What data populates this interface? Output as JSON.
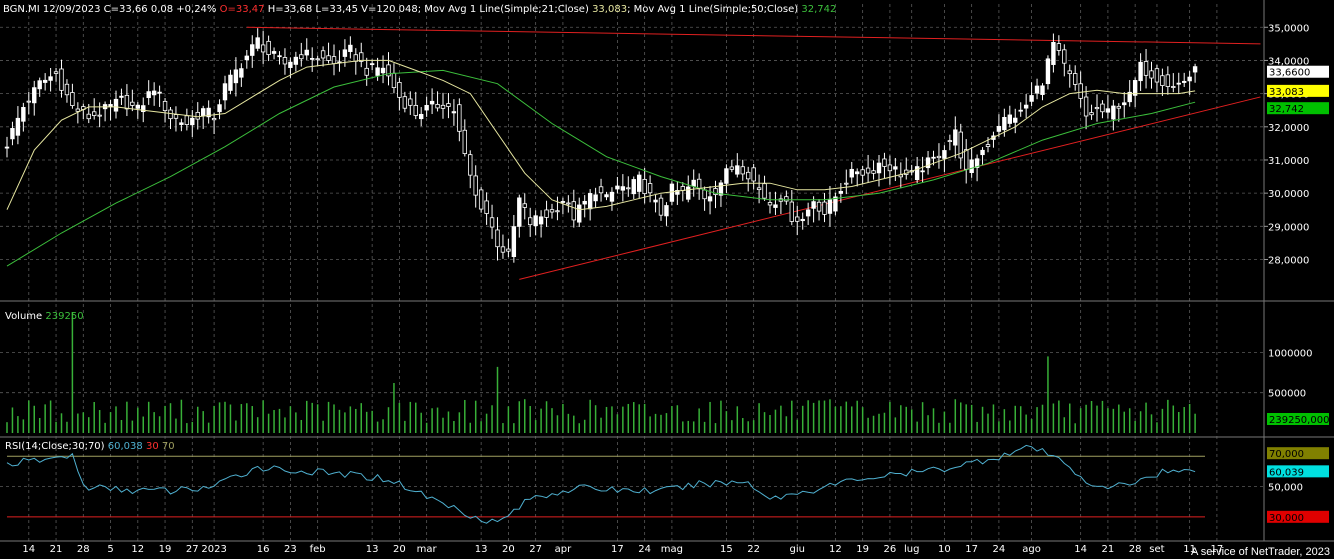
{
  "price_header": {
    "prefix": "BGN.MI 12/09/2023 C=33,66 0,08 +0,24%",
    "open": "O=33,47",
    "rest": "H=33,68 L=33,45 V=120.048; Mov Avg 1 Line(Simple;21;Close)",
    "ma21_value": "33,083",
    "ma50_label": "; Mov Avg 1 Line(Simple;50;Close)",
    "ma50_value": "32,742"
  },
  "volume_header": {
    "label": "Volume",
    "value": "239250"
  },
  "rsi_header": {
    "label": "RSI(14;Close;30;70)",
    "value": "60,038",
    "lower": "30",
    "upper": "70"
  },
  "credit": "A service of NetTrader, 2023",
  "colors": {
    "background": "#000000",
    "grid": "#5a5a5a",
    "axis": "#8a8a8a",
    "candle": "#ffffff",
    "ma21": "#e6e6a0",
    "ma50": "#3cbf3c",
    "trendline": "#e02020",
    "volume": "#38b038",
    "rsi": "#4fb0d0",
    "rsi70": "#a0a060",
    "rsi30": "#e02020"
  },
  "chart_data": [
    {
      "type": "candlestick",
      "name": "BGN.MI",
      "x_ticks": [
        {
          "label": "14",
          "i": 4
        },
        {
          "label": "21",
          "i": 9
        },
        {
          "label": "28",
          "i": 14
        },
        {
          "label": "5",
          "i": 19
        },
        {
          "label": "12",
          "i": 24
        },
        {
          "label": "19",
          "i": 29
        },
        {
          "label": "27",
          "i": 34
        },
        {
          "label": "2023",
          "i": 38
        },
        {
          "label": "16",
          "i": 47
        },
        {
          "label": "23",
          "i": 52
        },
        {
          "label": "feb",
          "i": 57
        },
        {
          "label": "13",
          "i": 67
        },
        {
          "label": "20",
          "i": 72
        },
        {
          "label": "mar",
          "i": 77
        },
        {
          "label": "13",
          "i": 87
        },
        {
          "label": "20",
          "i": 92
        },
        {
          "label": "27",
          "i": 97
        },
        {
          "label": "apr",
          "i": 102
        },
        {
          "label": "17",
          "i": 112
        },
        {
          "label": "24",
          "i": 117
        },
        {
          "label": "mag",
          "i": 122
        },
        {
          "label": "15",
          "i": 132
        },
        {
          "label": "22",
          "i": 137
        },
        {
          "label": "giu",
          "i": 145
        },
        {
          "label": "12",
          "i": 152
        },
        {
          "label": "19",
          "i": 157
        },
        {
          "label": "26",
          "i": 162
        },
        {
          "label": "lug",
          "i": 166
        },
        {
          "label": "10",
          "i": 172
        },
        {
          "label": "17",
          "i": 177
        },
        {
          "label": "24",
          "i": 182
        },
        {
          "label": "ago",
          "i": 188
        },
        {
          "label": "14",
          "i": 197
        },
        {
          "label": "21",
          "i": 202
        },
        {
          "label": "28",
          "i": 207
        },
        {
          "label": "set",
          "i": 211
        },
        {
          "label": "11",
          "i": 217
        },
        {
          "label": "17",
          "i": 222
        }
      ],
      "y_ticks": [
        "28,0000",
        "29,0000",
        "30,0000",
        "31,0000",
        "32,0000",
        "33,0000",
        "34,0000",
        "35,0000"
      ],
      "ylim": [
        26.9,
        35.4
      ],
      "close_path": [
        [
          0,
          31.5
        ],
        [
          3,
          32.6
        ],
        [
          6,
          33.3
        ],
        [
          9,
          33.6
        ],
        [
          12,
          32.6
        ],
        [
          15,
          32.3
        ],
        [
          18,
          32.5
        ],
        [
          21,
          32.8
        ],
        [
          24,
          32.5
        ],
        [
          27,
          33.2
        ],
        [
          30,
          32.3
        ],
        [
          33,
          32.1
        ],
        [
          36,
          32.5
        ],
        [
          38,
          32.3
        ],
        [
          40,
          33.2
        ],
        [
          43,
          33.9
        ],
        [
          46,
          34.6
        ],
        [
          48,
          34.2
        ],
        [
          51,
          33.9
        ],
        [
          54,
          34.2
        ],
        [
          57,
          34.1
        ],
        [
          60,
          33.9
        ],
        [
          63,
          34.3
        ],
        [
          66,
          33.7
        ],
        [
          69,
          33.8
        ],
        [
          72,
          32.9
        ],
        [
          75,
          32.4
        ],
        [
          78,
          32.6
        ],
        [
          80,
          32.7
        ],
        [
          82,
          32.5
        ],
        [
          84,
          31.1
        ],
        [
          86,
          29.9
        ],
        [
          88,
          29.4
        ],
        [
          90,
          28.5
        ],
        [
          92,
          28.1
        ],
        [
          94,
          29.8
        ],
        [
          96,
          29.1
        ],
        [
          98,
          29.3
        ],
        [
          100,
          29.4
        ],
        [
          102,
          29.8
        ],
        [
          104,
          29.3
        ],
        [
          106,
          29.7
        ],
        [
          108,
          30.1
        ],
        [
          110,
          29.8
        ],
        [
          112,
          30.2
        ],
        [
          114,
          30.1
        ],
        [
          116,
          30.4
        ],
        [
          118,
          29.9
        ],
        [
          120,
          29.4
        ],
        [
          122,
          30.1
        ],
        [
          124,
          30.0
        ],
        [
          126,
          30.3
        ],
        [
          128,
          29.9
        ],
        [
          130,
          30.1
        ],
        [
          132,
          30.6
        ],
        [
          134,
          30.9
        ],
        [
          136,
          30.6
        ],
        [
          138,
          30.1
        ],
        [
          140,
          29.7
        ],
        [
          142,
          29.9
        ],
        [
          144,
          29.3
        ],
        [
          146,
          29.2
        ],
        [
          148,
          29.8
        ],
        [
          150,
          29.4
        ],
        [
          152,
          29.9
        ],
        [
          154,
          30.4
        ],
        [
          156,
          30.7
        ],
        [
          158,
          30.6
        ],
        [
          160,
          30.9
        ],
        [
          162,
          30.8
        ],
        [
          164,
          30.6
        ],
        [
          166,
          30.5
        ],
        [
          168,
          30.8
        ],
        [
          170,
          31.0
        ],
        [
          172,
          31.4
        ],
        [
          174,
          31.8
        ],
        [
          176,
          30.6
        ],
        [
          178,
          31.1
        ],
        [
          180,
          31.5
        ],
        [
          182,
          32.1
        ],
        [
          184,
          32.3
        ],
        [
          186,
          32.4
        ],
        [
          188,
          32.9
        ],
        [
          190,
          33.4
        ],
        [
          192,
          34.5
        ],
        [
          194,
          33.8
        ],
        [
          196,
          33.2
        ],
        [
          198,
          32.3
        ],
        [
          200,
          32.5
        ],
        [
          202,
          32.4
        ],
        [
          204,
          32.7
        ],
        [
          206,
          32.9
        ],
        [
          208,
          33.8
        ],
        [
          210,
          33.6
        ],
        [
          212,
          33.4
        ],
        [
          214,
          33.2
        ],
        [
          216,
          33.4
        ],
        [
          218,
          33.66
        ]
      ],
      "ma21_path": [
        [
          0,
          29.5
        ],
        [
          5,
          31.3
        ],
        [
          10,
          32.2
        ],
        [
          15,
          32.6
        ],
        [
          20,
          32.6
        ],
        [
          25,
          32.5
        ],
        [
          30,
          32.4
        ],
        [
          35,
          32.3
        ],
        [
          40,
          32.4
        ],
        [
          45,
          32.9
        ],
        [
          50,
          33.4
        ],
        [
          55,
          33.8
        ],
        [
          60,
          33.9
        ],
        [
          65,
          34.0
        ],
        [
          70,
          34.0
        ],
        [
          75,
          33.7
        ],
        [
          80,
          33.4
        ],
        [
          85,
          33.0
        ],
        [
          90,
          31.8
        ],
        [
          95,
          30.6
        ],
        [
          100,
          29.8
        ],
        [
          105,
          29.5
        ],
        [
          110,
          29.6
        ],
        [
          115,
          29.8
        ],
        [
          120,
          30.0
        ],
        [
          125,
          30.1
        ],
        [
          130,
          30.2
        ],
        [
          135,
          30.3
        ],
        [
          140,
          30.3
        ],
        [
          145,
          30.1
        ],
        [
          150,
          30.1
        ],
        [
          155,
          30.2
        ],
        [
          160,
          30.4
        ],
        [
          165,
          30.6
        ],
        [
          170,
          30.9
        ],
        [
          175,
          31.2
        ],
        [
          180,
          31.6
        ],
        [
          185,
          32.0
        ],
        [
          190,
          32.6
        ],
        [
          195,
          33.0
        ],
        [
          200,
          33.1
        ],
        [
          205,
          33.0
        ],
        [
          210,
          33.0
        ],
        [
          215,
          33.0
        ],
        [
          218,
          33.083
        ]
      ],
      "ma50_path": [
        [
          0,
          27.8
        ],
        [
          10,
          28.8
        ],
        [
          20,
          29.7
        ],
        [
          30,
          30.5
        ],
        [
          40,
          31.4
        ],
        [
          50,
          32.4
        ],
        [
          60,
          33.2
        ],
        [
          70,
          33.6
        ],
        [
          80,
          33.7
        ],
        [
          90,
          33.3
        ],
        [
          100,
          32.1
        ],
        [
          110,
          31.1
        ],
        [
          120,
          30.5
        ],
        [
          130,
          30.0
        ],
        [
          140,
          29.8
        ],
        [
          150,
          29.8
        ],
        [
          160,
          30.0
        ],
        [
          170,
          30.4
        ],
        [
          180,
          30.9
        ],
        [
          190,
          31.6
        ],
        [
          200,
          32.1
        ],
        [
          210,
          32.4
        ],
        [
          218,
          32.742
        ]
      ],
      "trendlines": [
        {
          "from": [
            44,
            35.0
          ],
          "to": [
            230,
            34.5
          ]
        },
        {
          "from": [
            94,
            27.4
          ],
          "to": [
            230,
            32.9
          ]
        }
      ],
      "last_value_labels": [
        "33,6600",
        "33,083",
        "32,742"
      ]
    },
    {
      "type": "bar",
      "name": "Volume",
      "y_ticks": [
        "500000",
        "1000000"
      ],
      "ylim": [
        0,
        1600000
      ],
      "spikes": [
        [
          12,
          1500000
        ],
        [
          71,
          620000
        ],
        [
          90,
          820000
        ],
        [
          191,
          950000
        ]
      ],
      "last_value": "239250,000"
    },
    {
      "type": "line",
      "name": "RSI(14;Close;30;70)",
      "y_ticks": [
        "50,000"
      ],
      "ylim": [
        18,
        82
      ],
      "levels": [
        70,
        30
      ],
      "level_labels": [
        "70,000",
        "30,000"
      ],
      "path": [
        [
          0,
          65
        ],
        [
          8,
          68
        ],
        [
          12,
          71
        ],
        [
          14,
          50
        ],
        [
          20,
          48
        ],
        [
          30,
          47
        ],
        [
          38,
          50
        ],
        [
          46,
          63
        ],
        [
          54,
          60
        ],
        [
          62,
          58
        ],
        [
          70,
          55
        ],
        [
          78,
          42
        ],
        [
          86,
          30
        ],
        [
          90,
          26
        ],
        [
          96,
          42
        ],
        [
          104,
          49
        ],
        [
          112,
          48
        ],
        [
          120,
          47
        ],
        [
          128,
          52
        ],
        [
          136,
          53
        ],
        [
          140,
          42
        ],
        [
          148,
          48
        ],
        [
          156,
          55
        ],
        [
          164,
          58
        ],
        [
          172,
          62
        ],
        [
          180,
          68
        ],
        [
          188,
          76
        ],
        [
          194,
          66
        ],
        [
          200,
          48
        ],
        [
          206,
          52
        ],
        [
          212,
          60
        ],
        [
          218,
          60.038
        ]
      ],
      "last_value": "60,039"
    }
  ]
}
